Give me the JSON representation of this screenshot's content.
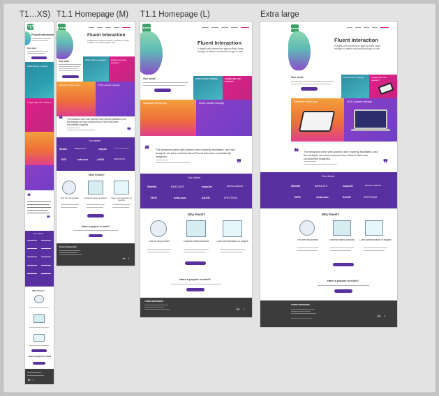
{
  "frames": {
    "xs": "T1…XS)",
    "m": "T1.1 Homepage (M)",
    "l": "T1.1 Homepage (L)",
    "xl": "Extra large"
  },
  "site": {
    "brand": "Fluent Interaction",
    "intro": "A digital web experience agency that's large enough to deliver and small enough to care",
    "work_heading": "Our work",
    "view_work": "View our work",
    "tiles": {
      "british_library": "British library redesign",
      "remote_app": "Ansgar app user research",
      "santander": "Santander finance app",
      "ncsc": "NCSC website redesign"
    },
    "quote_text": "The sessions were well planned and expertly facilitated, and the analysis we have received from Fluent has been consistently insightful.",
    "quote_close": "❞",
    "quote_open": "❝",
    "clients_heading": "Our clients",
    "clients": [
      "Shelter",
      "BARCLAYS",
      "easyJet",
      "BRITISH LIBRARY",
      "TATE",
      "sofa.com",
      "AXON",
      "SPECTRUM"
    ],
    "why_heading": "Why Fluent?",
    "why_items": [
      {
        "title": "Find the real problem",
        "icon": "microscope-icon"
      },
      {
        "title": "Evidence based solutions",
        "icon": "document-chart-icon"
      },
      {
        "title": "Clear communication of insights",
        "icon": "presentation-icon"
      }
    ],
    "why_button": "View our services",
    "project_heading": "Have a project in mind?",
    "project_button": "Get in touch",
    "footer_brand": "Fluent Interaction",
    "social": {
      "linkedin": "in",
      "twitter": "t"
    }
  },
  "colors": {
    "purple": "#5930a0",
    "pink": "#e01f8b",
    "green": "#3f9f6a",
    "footer": "#3c3c3c"
  }
}
